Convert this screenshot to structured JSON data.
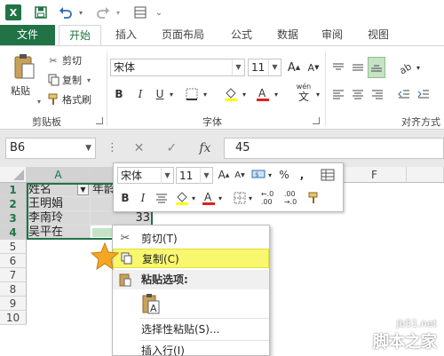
{
  "quick_access": {
    "save_icon": "save-icon",
    "undo_icon": "undo-icon",
    "redo_icon": "redo-icon",
    "customize_icon": "customize-icon"
  },
  "tabs": [
    {
      "label": "文件"
    },
    {
      "label": "开始"
    },
    {
      "label": "插入"
    },
    {
      "label": "页面布局"
    },
    {
      "label": "公式"
    },
    {
      "label": "数据"
    },
    {
      "label": "审阅"
    },
    {
      "label": "视图"
    }
  ],
  "ribbon": {
    "clipboard": {
      "paste": "粘贴",
      "cut": "剪切",
      "copy": "复制",
      "format_painter": "格式刷",
      "group_label": "剪贴板"
    },
    "font": {
      "font_name": "宋体",
      "font_size": "11",
      "bold": "B",
      "italic": "I",
      "underline": "U",
      "wen": "wén",
      "wen_char": "文",
      "group_label": "字体"
    },
    "alignment": {
      "group_label": "对齐方式"
    }
  },
  "formula_bar": {
    "name_box": "B6",
    "cancel": "✕",
    "enter": "✓",
    "fx": "fx",
    "value": "45"
  },
  "sheet": {
    "columns": [
      "A",
      "",
      "F"
    ],
    "rows": [
      "1",
      "2",
      "3",
      "4",
      "5",
      "6",
      "7",
      "8",
      "9",
      "10"
    ],
    "cells": {
      "a1": "姓名",
      "b1": "年龄",
      "a2": "王明娟",
      "a3": "李南玲",
      "b3": "33",
      "a4": "吴平在"
    }
  },
  "mini_toolbar": {
    "font_name": "宋体",
    "font_size": "11",
    "percent": "%",
    "comma": ",",
    "bold": "B",
    "italic": "I"
  },
  "context_menu": {
    "cut": "剪切(T)",
    "copy": "复制(C)",
    "paste_options": "粘贴选项:",
    "paste_special": "选择性粘贴(S)...",
    "insert_row": "插入行(I)"
  },
  "watermark": {
    "url": "jb51.net",
    "name": "脚本之家"
  },
  "colors": {
    "brand": "#217346",
    "highlight": "#f8f76e",
    "star": "#f5a623"
  }
}
